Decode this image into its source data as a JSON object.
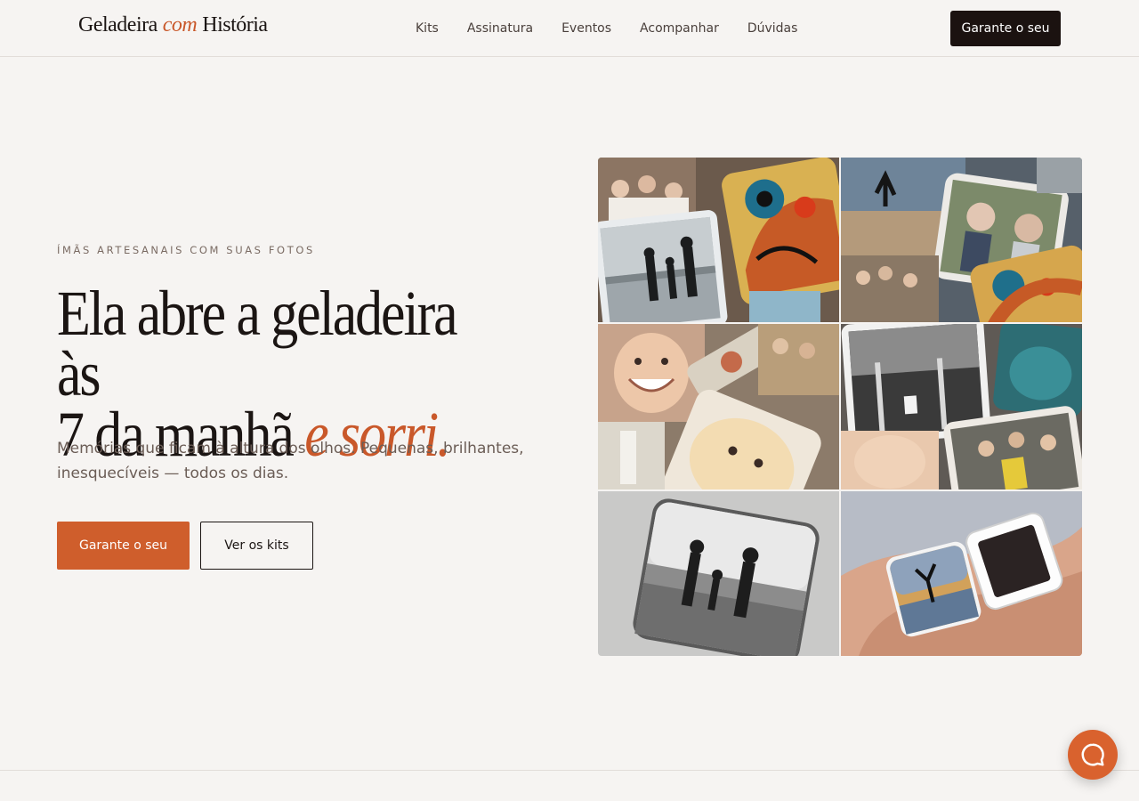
{
  "brand": {
    "part1": "Geladeira",
    "part2": "com",
    "part3": "História"
  },
  "nav": {
    "items": [
      "Kits",
      "Assinatura",
      "Eventos",
      "Acompanhar",
      "Dúvidas"
    ]
  },
  "header": {
    "cta_label": "Garante o seu"
  },
  "hero": {
    "eyebrow": "ÍMÃS ARTESANAIS COM SUAS FOTOS",
    "headline_line1": "Ela abre a geladeira às",
    "headline_line2": "7 da manhã",
    "headline_accent": "e sorri.",
    "subtitle": "Memórias que ficam à altura dos olhos. Pequenas, brilhantes, inesquecíveis — todos os dias.",
    "primary_button": "Garante o seu",
    "secondary_button": "Ver os kits"
  },
  "colors": {
    "accent": "#cf5e2c",
    "dark": "#1b1210",
    "background": "#f6f4f2"
  },
  "icons": {
    "chat": "chat-bubble-icon"
  }
}
